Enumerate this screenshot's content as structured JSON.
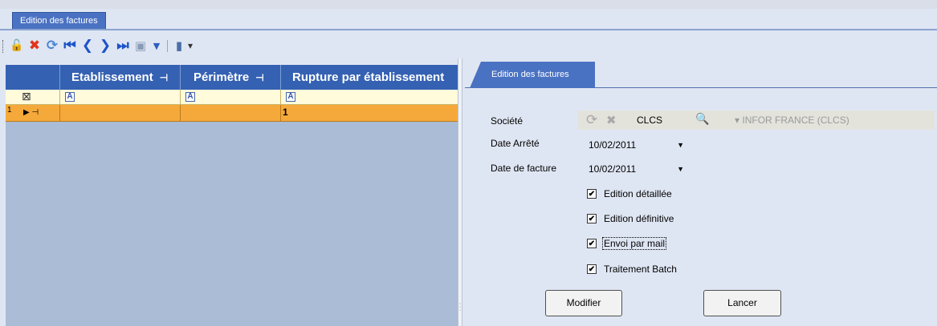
{
  "window": {
    "tab_title": "Edition des factures"
  },
  "toolbar": {
    "icons": [
      "lock-icon",
      "delete-icon",
      "refresh-icon",
      "first-icon",
      "prev-icon",
      "next-icon",
      "last-icon",
      "box-icon",
      "dropdown-icon",
      "export-icon",
      "dropdown-icon"
    ],
    "glyphs": {
      "lock": "🔓",
      "delete": "✖",
      "refresh": "⟳",
      "first": "⏮",
      "prev": "❮",
      "next": "❯",
      "last": "⏭",
      "box": "▣",
      "caret": "▼",
      "export": "▮",
      "caret_small": "▾"
    }
  },
  "grid": {
    "columns": [
      {
        "label": "Etablissement"
      },
      {
        "label": "Périmètre"
      },
      {
        "label": "Rupture par établissement"
      }
    ],
    "pin_glyph": "⊣",
    "filter_glyph": "A",
    "filter_clear_glyph": "⊠",
    "rows": [
      {
        "index": "1",
        "marker": "▶ ⊣",
        "rupture": "1"
      }
    ]
  },
  "panel": {
    "tab_title": "Edition des factures",
    "societe": {
      "label": "Société",
      "code": "CLCS",
      "name": "▾  INFOR FRANCE (CLCS)",
      "icons": {
        "refresh": "⟳",
        "clear": "✖",
        "search": "🔍"
      }
    },
    "date_arrete": {
      "label": "Date Arrêté",
      "value": "10/02/2011"
    },
    "date_facture": {
      "label": "Date de facture",
      "value": "10/02/2011"
    },
    "dropdown_arrow": "▼",
    "checkboxes": [
      {
        "label": "Edition détaillée",
        "checked": true
      },
      {
        "label": "Edition définitive",
        "checked": true
      },
      {
        "label": "Envoi par mail",
        "checked": true
      },
      {
        "label": "Traitement Batch",
        "checked": true
      }
    ],
    "check_mark": "✔",
    "buttons": {
      "modifier": "Modifier",
      "lancer": "Lancer"
    }
  },
  "colors": {
    "accent": "#4a72c2",
    "grid_header": "#3561b3",
    "grid_body": "#aabcd6",
    "row_selected": "#f5a93a",
    "filter_row": "#fffbdb"
  }
}
